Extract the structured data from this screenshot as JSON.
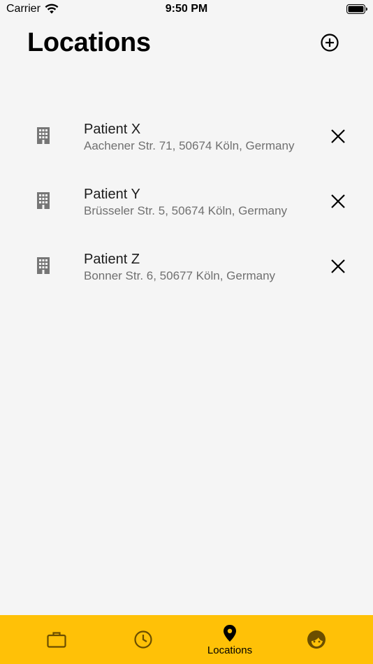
{
  "status_bar": {
    "carrier": "Carrier",
    "time": "9:50 PM"
  },
  "header": {
    "title": "Locations",
    "add_icon": "add-circle-icon"
  },
  "locations": [
    {
      "name": "Patient X",
      "address": "Aachener Str. 71, 50674 Köln, Germany",
      "icon": "building-icon"
    },
    {
      "name": "Patient Y",
      "address": "Brüsseler Str. 5, 50674 Köln, Germany",
      "icon": "building-icon"
    },
    {
      "name": "Patient Z",
      "address": "Bonner Str. 6, 50677 Köln, Germany",
      "icon": "building-icon"
    }
  ],
  "tab_bar": {
    "background": "#ffc107",
    "tabs": [
      {
        "icon": "briefcase-icon",
        "label": "",
        "selected": false
      },
      {
        "icon": "clock-icon",
        "label": "",
        "selected": false
      },
      {
        "icon": "location-pin-icon",
        "label": "Locations",
        "selected": true
      },
      {
        "icon": "face-icon",
        "label": "",
        "selected": false
      }
    ]
  }
}
